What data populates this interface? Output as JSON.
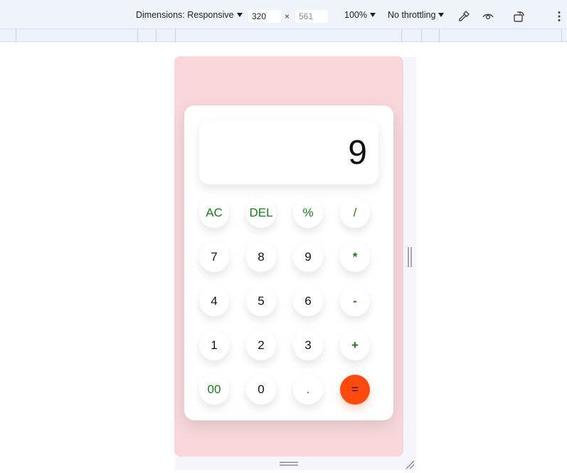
{
  "devtools": {
    "dimensions_label": "Dimensions: Responsive",
    "width_value": "320",
    "height_placeholder": "561",
    "times": "×",
    "zoom": "100%",
    "throttling": "No throttling"
  },
  "calculator": {
    "display_value": "9",
    "rows": [
      [
        {
          "label": "AC",
          "kind": "op"
        },
        {
          "label": "DEL",
          "kind": "op"
        },
        {
          "label": "%",
          "kind": "op"
        },
        {
          "label": "/",
          "kind": "op"
        }
      ],
      [
        {
          "label": "7",
          "kind": "num"
        },
        {
          "label": "8",
          "kind": "num"
        },
        {
          "label": "9",
          "kind": "num"
        },
        {
          "label": "*",
          "kind": "op"
        }
      ],
      [
        {
          "label": "4",
          "kind": "num"
        },
        {
          "label": "5",
          "kind": "num"
        },
        {
          "label": "6",
          "kind": "num"
        },
        {
          "label": "-",
          "kind": "op"
        }
      ],
      [
        {
          "label": "1",
          "kind": "num"
        },
        {
          "label": "2",
          "kind": "num"
        },
        {
          "label": "3",
          "kind": "num"
        },
        {
          "label": "+",
          "kind": "op"
        }
      ],
      [
        {
          "label": "00",
          "kind": "op"
        },
        {
          "label": "0",
          "kind": "num"
        },
        {
          "label": ".",
          "kind": "op"
        },
        {
          "label": "=",
          "kind": "eq"
        }
      ]
    ]
  },
  "colors": {
    "device_background": "#f7d7da",
    "operator_text": "#1a7a1a",
    "equals_button": "#ff4a0f",
    "toolbar_background": "#eff3fa"
  },
  "icons": [
    "caret-down-icon",
    "eyedropper-icon",
    "eye-icon",
    "device-rotate-icon",
    "more-vertical-icon"
  ]
}
